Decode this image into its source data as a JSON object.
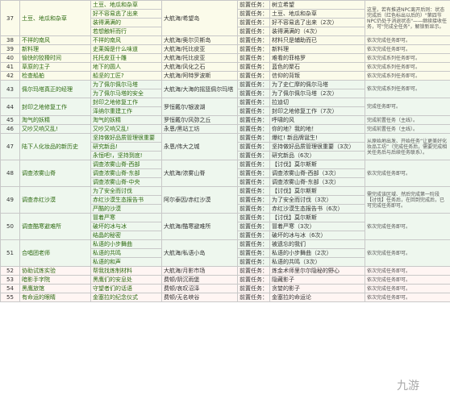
{
  "rows": [
    {
      "no": "37",
      "quest": "土豆、地瓜和杂草",
      "subs": [
        "土豆、地瓜和杂草",
        "好不容易逃了出来",
        "装得满满的",
        "若想触轩而行"
      ],
      "loc": "大航海/希望岛",
      "pre": [
        "前置任务：",
        "前置任务：",
        "前置任务：",
        "前置任务："
      ],
      "pre_items": [
        "树立希望",
        "土豆、地瓜和杂草",
        "好不容易逃了出来（2次）",
        "装得满满的（4次）"
      ],
      "note": "这里，若有推进NPC离开后则：状态完成后（红色标出以后的）\"第四节NPC仍处于消退状态\"——继续接收任务，可\"完成全任务\"，解锁新显示。",
      "span": 4,
      "bg": "a"
    },
    {
      "no": "38",
      "quest": "不祥的南风",
      "subs": [
        "不祥的南风"
      ],
      "loc": "大航海/奥尔贝斯岛",
      "pre": [
        "前置任务："
      ],
      "pre_items": [
        "材料只是辅助而已"
      ],
      "note": "依次完成任务即可。",
      "span": 1,
      "bg": "a"
    },
    {
      "no": "39",
      "quest": "新料理",
      "subs": [
        "史莱姆是什么味道"
      ],
      "loc": "大航海/托比皮亚",
      "pre": [
        "前置任务："
      ],
      "pre_items": [
        "新料理"
      ],
      "note": "依次完成任务即可。",
      "span": 1,
      "bg": "a"
    },
    {
      "no": "40",
      "quest": "愉快的狡猾时间",
      "subs": [
        "托托皮亚十雕"
      ],
      "loc": "大航海/托比皮亚",
      "pre": [
        "前置任务："
      ],
      "pre_items": [
        "难看的菲格罗"
      ],
      "note": "依次完成系列任务即可。",
      "span": 1,
      "bg": "a"
    },
    {
      "no": "41",
      "quest": "草原的主子",
      "subs": [
        "地下的圆人"
      ],
      "loc": "大航海/风化之石",
      "pre": [
        "前置任务："
      ],
      "pre_items": [
        "蓝色的聚石"
      ],
      "note": "依次完成系列任务即可。",
      "span": 1,
      "bg": "a"
    },
    {
      "no": "42",
      "quest": "检查船舶",
      "subs": [
        "船坚的工匠?"
      ],
      "loc": "大航海/阿特罗波斯",
      "pre": [
        "前置任务："
      ],
      "pre_items": [
        "信仰的背叛"
      ],
      "note": "依次完成系列任务即可。",
      "span": 1,
      "bg": "a"
    },
    {
      "no": "43",
      "quest": "佩尔玛塔真正的经理",
      "subs": [
        "为了佩尔佩尔马塔",
        "为了佩尔马塔的安全"
      ],
      "loc": "大航海/大海的摇篮佩尔玛塔",
      "pre": [
        "前置任务：",
        "前置任务："
      ],
      "pre_items": [
        "为了史仁摩的佩尔马塔",
        "为了佩尔佩尔马塔（2次）"
      ],
      "note": "依次完成系列任务即可。",
      "span": 2,
      "bg": "b"
    },
    {
      "no": "44",
      "quest": "封印之地修复工作",
      "subs": [
        "封印之地修复工作",
        "泽纳尔重建工作"
      ],
      "loc": "罗恒戴尔/银波湖",
      "pre": [
        "前置任务：",
        "前置任务："
      ],
      "pre_items": [
        "拉迪切",
        "封印之地修复工作（7次）"
      ],
      "note": "完成任务即可。",
      "span": 2,
      "bg": "b"
    },
    {
      "no": "45",
      "quest": "淘气的妖精",
      "subs": [
        "淘气的妖精"
      ],
      "loc": "罗恒戴尔/风弥之丘",
      "pre": [
        "前置任务："
      ],
      "pre_items": [
        "呼啸的风"
      ],
      "note": "完成前置任务（主线）。",
      "span": 1,
      "bg": "b"
    },
    {
      "no": "46",
      "quest": "又吵又响又乱!",
      "subs": [
        "又吵又响又乱!"
      ],
      "loc": "永恩/黑站工坊",
      "pre": [
        "前置任务："
      ],
      "pre_items": [
        "你的地？我的地！"
      ],
      "note": "完成前置任务（主线）。",
      "span": 1,
      "bg": "b"
    },
    {
      "no": "47",
      "quest": "陆下人化妆品的新历史",
      "subs": [
        "坚持做好品质管理很重要",
        "研究新品!",
        "永恒吧!，坚持到底!"
      ],
      "loc": "永恩/伟大之城",
      "pre": [
        "前置任务：",
        "前置任务：",
        "前置任务："
      ],
      "pre_items": [
        "爆红! 新品牌诞生!",
        "坚持做好品质管理很重要（3次）",
        "研究新品（6次）"
      ],
      "note": "从原始地出发、开始任务“让更美好化妆品工坊”（完成任务后，需要完成相关任务后与后续任务联系）。",
      "span": 3,
      "bg": "b"
    },
    {
      "no": "48",
      "quest": "调查浓雾山脊",
      "subs": [
        "调查浓雾山脊-西部",
        "调查浓雾山脊-东部",
        "调查浓雾山脊-中央"
      ],
      "loc": "大航海/浓雾山脊",
      "pre": [
        "前置任务：",
        "前置任务：",
        "前置任务："
      ],
      "pre_items": [
        "【讨伐】莫尔斯斯",
        "调查浓雾山脊-西部（3次）",
        "调查浓雾山脊-东部（3次）"
      ],
      "note": "依次完成任务即可。",
      "span": 3,
      "bg": "b"
    },
    {
      "no": "49",
      "quest": "调查赤红沙漠",
      "subs": [
        "为了安全而讨伐",
        "赤红沙漠生态报告书",
        "严酷的沙漠"
      ],
      "loc": "阿尔泰因/赤红沙漠",
      "pre": [
        "前置任务：",
        "前置任务：",
        "前置任务："
      ],
      "pre_items": [
        "【讨伐】莫尔斯斯",
        "为了安全而讨伐（3次）",
        "赤红沙漠生态报告书（6次）"
      ],
      "note": "需完成该区域、然后完成第一阶段【讨伐】任务后，在回到完成后，已可完成任务即可。",
      "span": 3,
      "bg": "b"
    },
    {
      "no": "50",
      "quest": "调查酷寒避难所",
      "subs": [
        "冒着严寒",
        "破坏的冰与冰",
        "结晶的秘密"
      ],
      "loc": "大航海/酷寒避难所",
      "pre": [
        "前置任务：",
        "前置任务：",
        "前置任务："
      ],
      "pre_items": [
        "【讨伐】莫尔斯斯",
        "冒着严寒（3次）",
        "破坏的冰与冰（6次）"
      ],
      "note": "依次完成任务即可。",
      "span": 3,
      "bg": "b"
    },
    {
      "no": "51",
      "quest": "合唱团老师",
      "subs": [
        "私语的小步舞曲",
        "私语的共鸣",
        "私语的和声"
      ],
      "loc": "大航海/私语小岛",
      "pre": [
        "前置任务：",
        "前置任务：",
        "前置任务："
      ],
      "pre_items": [
        "被遗忘的我们",
        "私语的小步舞曲（2次）",
        "私语的共鸣（3次）"
      ],
      "note": "依次完成任务即可。",
      "span": 3,
      "bg": "b"
    },
    {
      "no": "52",
      "quest": "协助试炼实验",
      "subs": [
        "帮我找炼制材料"
      ],
      "loc": "大航海/月影市场",
      "pre": [
        "前置任务："
      ],
      "pre_items": [
        "炼金术师里尔尔隐秘的野心"
      ],
      "note": "依次完成任务即可。",
      "span": 1,
      "bg": "c"
    },
    {
      "no": "53",
      "quest": "暗影手字院",
      "subs": [
        "黑鹰们的安息处"
      ],
      "loc": "费顿/阴沉雨堡",
      "pre": [
        "前置任务："
      ],
      "pre_items": [
        "隐藏影子"
      ],
      "note": "依次完成任务即可。",
      "span": 1,
      "bg": "c"
    },
    {
      "no": "54",
      "quest": "黑鹰旅馆",
      "subs": [
        "守望者们的话语"
      ],
      "loc": "费顿/哀叹沼泽",
      "pre": [
        "前置任务："
      ],
      "pre_items": [
        "贪婪的影子"
      ],
      "note": "依次完成任务即可。",
      "span": 1,
      "bg": "c"
    },
    {
      "no": "55",
      "quest": "有命运的眼睛",
      "subs": [
        "金塞拉的纪念仪式"
      ],
      "loc": "费顿/无名峡谷",
      "pre": [
        "前置任务："
      ],
      "pre_items": [
        "金塞拉的命运论"
      ],
      "note": "依次完成任务即可。",
      "span": 1,
      "bg": "c"
    }
  ],
  "watermark": "九游"
}
